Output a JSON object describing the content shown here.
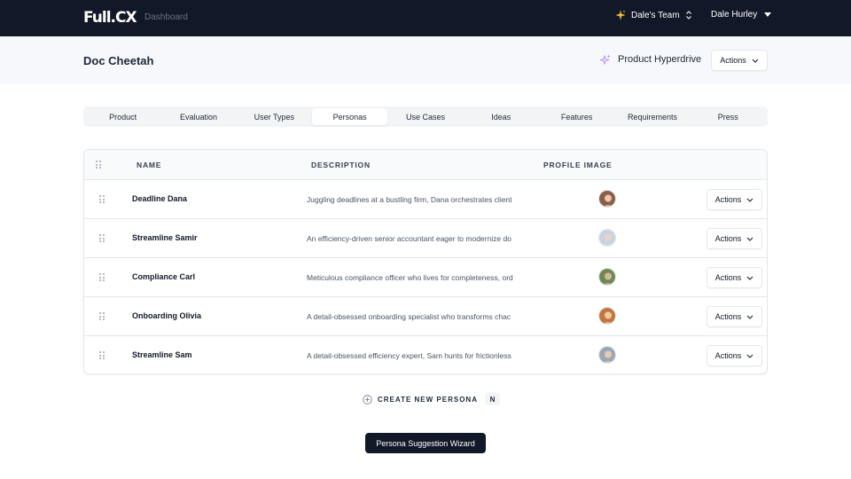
{
  "nav": {
    "logo": "Full.CX",
    "dashboard_link": "Dashboard",
    "team_name": "Dale's Team",
    "user_name": "Dale Hurley"
  },
  "header": {
    "page_title": "Doc Cheetah",
    "hyperdrive_label": "Product Hyperdrive",
    "actions_label": "Actions"
  },
  "tabs": [
    {
      "label": "Product",
      "active": false
    },
    {
      "label": "Evaluation",
      "active": false
    },
    {
      "label": "User Types",
      "active": false
    },
    {
      "label": "Personas",
      "active": true
    },
    {
      "label": "Use Cases",
      "active": false
    },
    {
      "label": "Ideas",
      "active": false
    },
    {
      "label": "Features",
      "active": false
    },
    {
      "label": "Requirements",
      "active": false
    },
    {
      "label": "Press",
      "active": false
    }
  ],
  "table": {
    "columns": {
      "name": "NAME",
      "description": "DESCRIPTION",
      "profile_image": "PROFILE IMAGE"
    },
    "rows": [
      {
        "name": "Deadline Dana",
        "description": "Juggling deadlines at a bustling firm, Dana orchestrates client",
        "actions_label": "Actions",
        "avatar_bg": "#8b5e4a",
        "avatar_fg": "#e9c7b1"
      },
      {
        "name": "Streamline Samir",
        "description": "An efficiency-driven senior accountant eager to modernize do",
        "actions_label": "Actions",
        "avatar_bg": "#c7d3e0",
        "avatar_fg": "#e8d4c2"
      },
      {
        "name": "Compliance Carl",
        "description": "Meticulous compliance officer who lives for completeness, ord",
        "actions_label": "Actions",
        "avatar_bg": "#6d8a55",
        "avatar_fg": "#d8b79a"
      },
      {
        "name": "Onboarding Olivia",
        "description": "A detail-obsessed onboarding specialist who transforms chac",
        "actions_label": "Actions",
        "avatar_bg": "#c2773d",
        "avatar_fg": "#f0c9a6"
      },
      {
        "name": "Streamline Sam",
        "description": "A detail-obsessed efficiency expert, Sam hunts for frictionless",
        "actions_label": "Actions",
        "avatar_bg": "#9aa7b5",
        "avatar_fg": "#e6cbb3"
      }
    ]
  },
  "create_new": {
    "label": "CREATE NEW PERSONA",
    "shortcut": "N"
  },
  "wizard_button": "Persona Suggestion Wizard",
  "colors": {
    "nav_bg": "#111827",
    "accent_sparkle": "#f5b73b",
    "hyperdrive_icon": "#a78bfa"
  }
}
